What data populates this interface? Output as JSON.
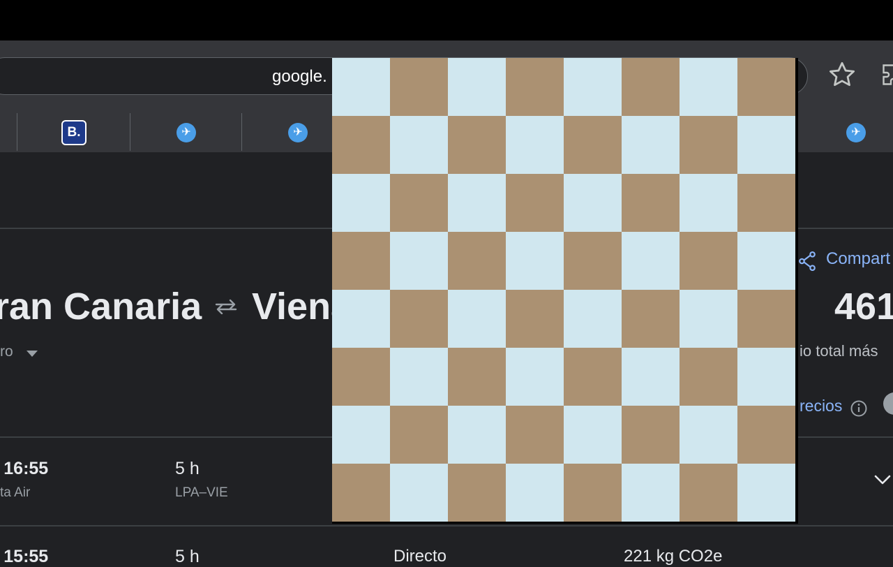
{
  "browser": {
    "address": "google.",
    "icons": {
      "bookmark": "star-icon",
      "extensions": "puzzle-icon"
    }
  },
  "bookmarks_bar": {
    "items": [
      {
        "kind": "booking",
        "label": "B."
      },
      {
        "kind": "plane",
        "icon": "airplane-icon"
      },
      {
        "kind": "plane",
        "icon": "airplane-icon"
      },
      {
        "kind": "plane",
        "icon": "airplane-icon"
      }
    ]
  },
  "search": {
    "origin": "ran Canaria",
    "destination": "Viena",
    "trip_type": "ro",
    "swap_icon": "swap-arrows-icon"
  },
  "summary": {
    "share_label": "Compart",
    "price": "461",
    "price_caption": "io total más",
    "track_label": "recios"
  },
  "flights": [
    {
      "time": "- 16:55",
      "airline": "ta Air",
      "duration": "5 h",
      "route": "LPA–VIE",
      "stops": "",
      "co2": ""
    },
    {
      "time": "- 15:55",
      "airline": "",
      "duration": "5 h",
      "route": "",
      "stops": "Directo",
      "co2": "221 kg CO2e"
    }
  ],
  "overlay": {
    "type": "checkerboard",
    "rows": 8,
    "cols": 8,
    "colors": {
      "light": "#d0e7ef",
      "dark": "#ab9172"
    }
  },
  "colors": {
    "page_bg": "#202124",
    "toolbar_bg": "#35363a",
    "link": "#8ab4f8"
  }
}
